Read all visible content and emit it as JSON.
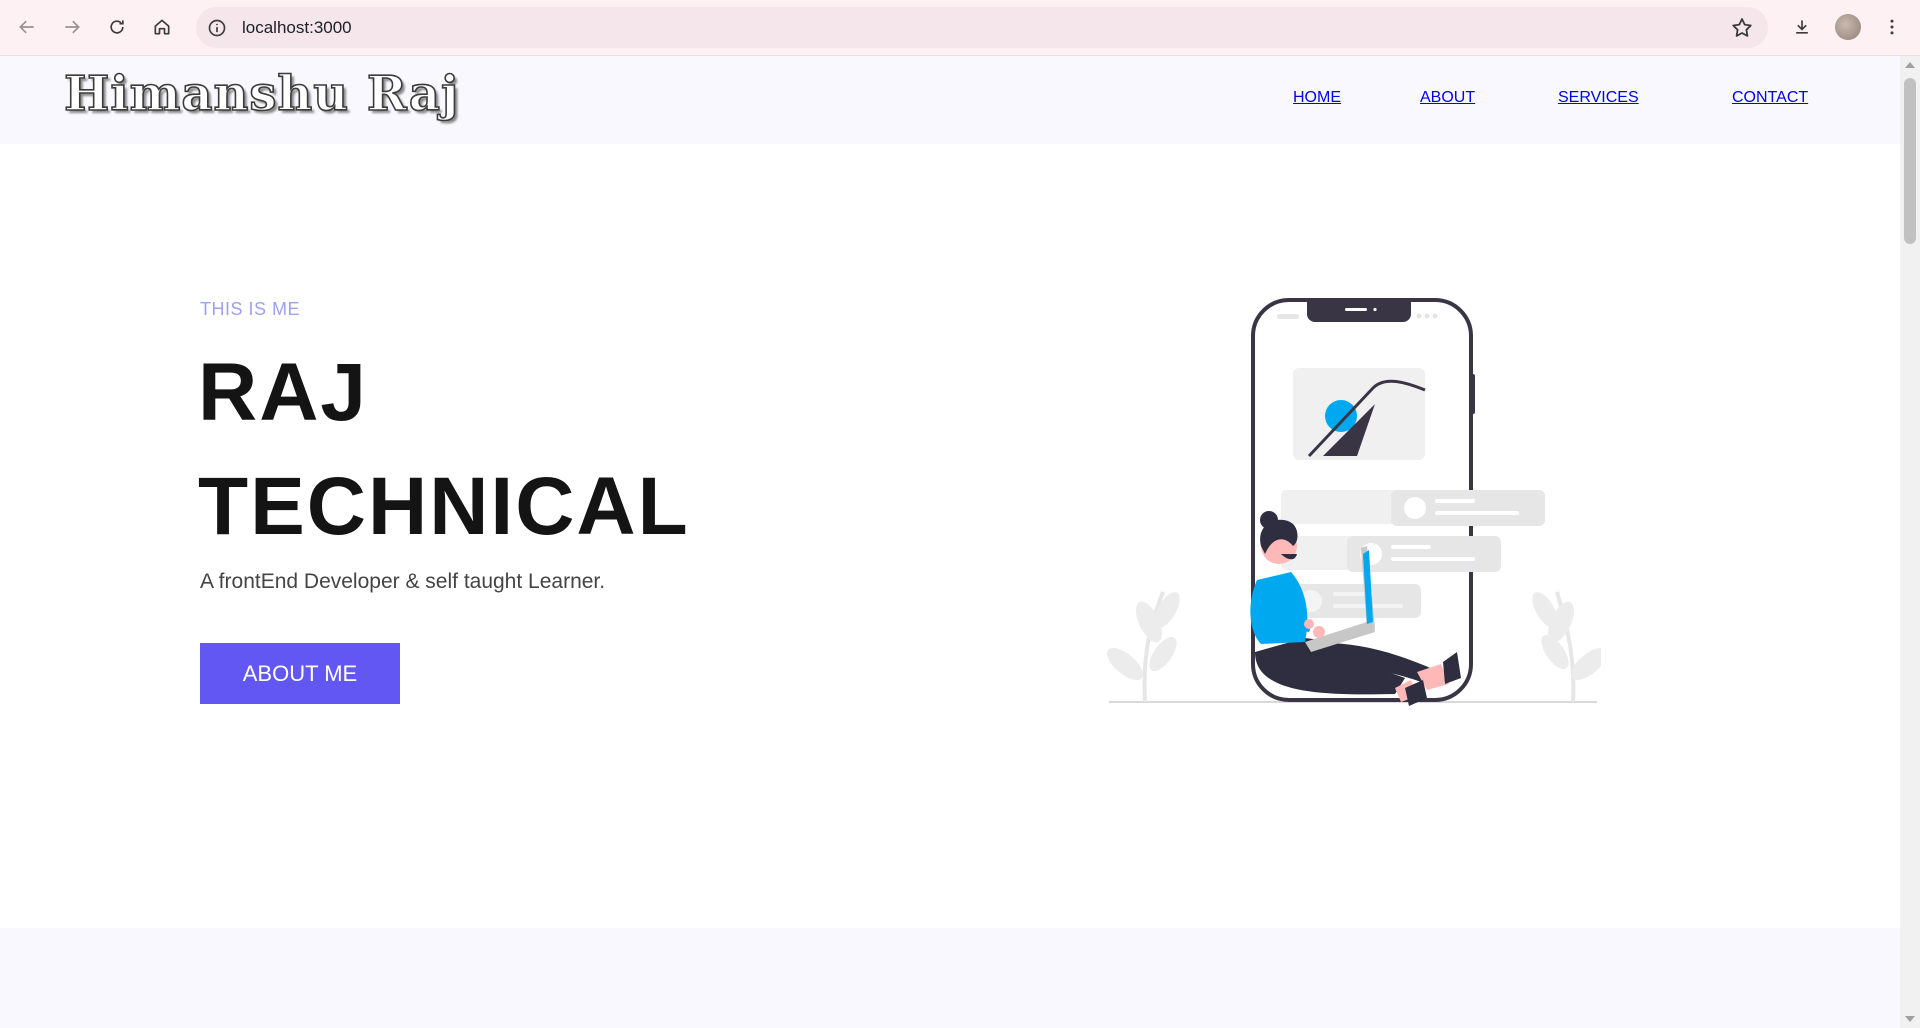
{
  "browser": {
    "url": "localhost:3000",
    "icons": [
      "back-arrow-icon",
      "forward-arrow-icon",
      "reload-icon",
      "home-icon",
      "info-icon",
      "star-icon",
      "download-icon",
      "kebab-menu-icon"
    ]
  },
  "header": {
    "logo": "Himanshu Raj",
    "nav": [
      {
        "label": "HOME"
      },
      {
        "label": "ABOUT"
      },
      {
        "label": "SERVICES"
      },
      {
        "label": "CONTACT"
      }
    ]
  },
  "hero": {
    "subtitle": "THIS IS ME",
    "title_line1": "RAJ",
    "title_line2": "TECHNICAL",
    "description": "A frontEnd Developer & self taught Learner.",
    "button": "ABOUT ME"
  },
  "colors": {
    "accent": "#6257f3",
    "subtitle": "#9fa0f0",
    "illustration_blue": "#00a8f0",
    "illustration_dark": "#3a3545"
  }
}
